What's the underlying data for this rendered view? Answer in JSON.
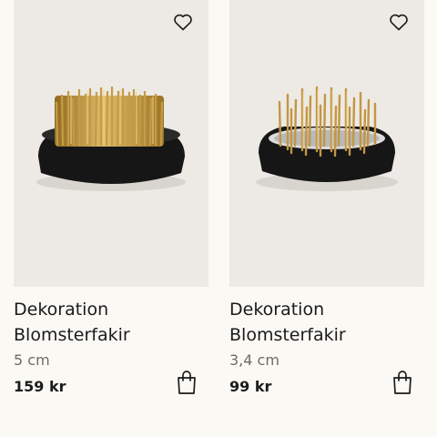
{
  "products": [
    {
      "name_line1": "Dekoration",
      "name_line2": "Blomsterfakir",
      "size": "5 cm",
      "price": "159 kr",
      "icons": {
        "favorite": "heart-icon",
        "cart": "shopping-bag-icon"
      }
    },
    {
      "name_line1": "Dekoration",
      "name_line2": "Blomsterfakir",
      "size": "3,4 cm",
      "price": "99 kr",
      "icons": {
        "favorite": "heart-icon",
        "cart": "shopping-bag-icon"
      }
    }
  ],
  "colors": {
    "page_background": "#fbf9f4",
    "image_background": "#edeae5",
    "text": "#1b1b1b",
    "muted_text": "#6c6c6c"
  }
}
